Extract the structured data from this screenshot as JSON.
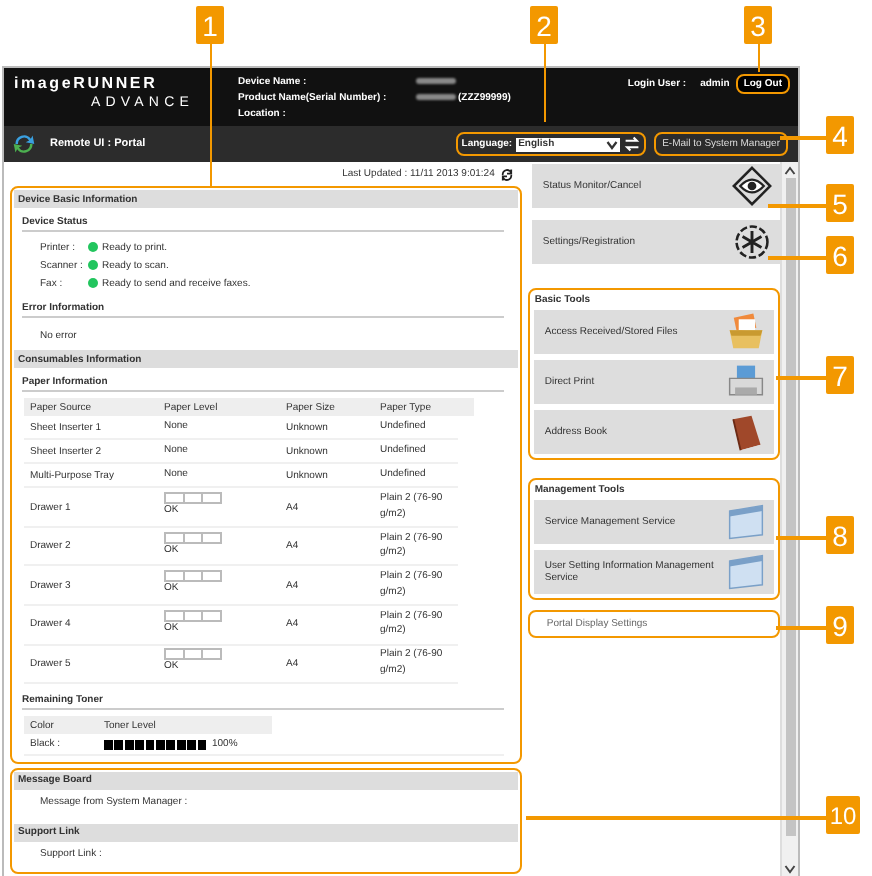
{
  "callouts": [
    "1",
    "2",
    "3",
    "4",
    "5",
    "6",
    "7",
    "8",
    "9",
    "10"
  ],
  "header": {
    "logo": [
      "imageRUNNER",
      "ADVANCE"
    ],
    "device_fields": [
      {
        "label": "Device Name :",
        "blurred": true
      },
      {
        "label": "Product Name(Serial Number) :",
        "blurred": true,
        "value": "(ZZZ99999)"
      },
      {
        "label": "Location :",
        "blurred": false
      }
    ],
    "login_label": "Login User :",
    "user": "admin",
    "logout": "Log Out"
  },
  "toolbar": {
    "title": "Remote UI : Portal",
    "language_label": "Language:",
    "language": "English",
    "email_button": "E-Mail to System Manager"
  },
  "last_updated": "Last Updated : 11/11 2013 9:01:24",
  "device_basic": {
    "title": "Device Basic Information",
    "status_title": "Device Status",
    "statuses": [
      {
        "label": "Printer :",
        "text": "Ready to print.",
        "color": "#22c55e"
      },
      {
        "label": "Scanner :",
        "text": "Ready to scan.",
        "color": "#22c55e"
      },
      {
        "label": "Fax :",
        "text": "Ready to send and receive faxes.",
        "color": "#22c55e"
      }
    ],
    "error_title": "Error Information",
    "error_text": "No error"
  },
  "consumables": {
    "title": "Consumables Information",
    "paper_title": "Paper Information",
    "columns": [
      "Paper Source",
      "Paper Level",
      "Paper Size",
      "Paper Type"
    ],
    "rows": [
      {
        "kind": "text",
        "source": "Sheet Inserter 1",
        "level_text": "None",
        "size": "Unknown",
        "type": "Undefined"
      },
      {
        "kind": "text",
        "source": "Sheet Inserter 2",
        "level_text": "None",
        "size": "Unknown",
        "type": "Undefined"
      },
      {
        "kind": "text",
        "source": "Multi-Purpose Tray",
        "level_text": "None",
        "size": "Unknown",
        "type": "Undefined"
      },
      {
        "kind": "gauge",
        "source": "Drawer 1",
        "level_text": "OK",
        "size": "A4",
        "type": "Plain 2 (76-90 g/m2)"
      },
      {
        "kind": "gauge",
        "source": "Drawer 2",
        "level_text": "OK",
        "size": "A4",
        "type": "Plain 2 (76-90 g/m2)"
      },
      {
        "kind": "gauge",
        "source": "Drawer 3",
        "level_text": "OK",
        "size": "A4",
        "type": "Plain 2 (76-90 g/m2)"
      },
      {
        "kind": "gauge",
        "source": "Drawer 4",
        "level_text": "OK",
        "size": "A4",
        "type": "Plain 2 (76-90 g/m2)"
      },
      {
        "kind": "gauge",
        "source": "Drawer 5",
        "level_text": "OK",
        "size": "A4",
        "type": "Plain 2 (76-90 g/m2)"
      }
    ],
    "toner_title": "Remaining Toner",
    "toner_columns": [
      "Color",
      "Toner Level"
    ],
    "toner": [
      {
        "name": "Black :",
        "level": 1,
        "reading": "100%"
      }
    ]
  },
  "message_board": {
    "title": "Message Board",
    "text": "Message from System Manager :"
  },
  "support": {
    "title": "Support Link",
    "text": "Support Link :"
  },
  "right": {
    "main_buttons": [
      {
        "label": "Status Monitor/Cancel",
        "kind": "eye"
      },
      {
        "label": "Settings/Registration",
        "kind": "gear"
      }
    ],
    "groups": [
      {
        "title": "Basic Tools",
        "buttons": [
          {
            "label": "Access Received/Stored Files",
            "kind": "files"
          },
          {
            "label": "Direct Print",
            "kind": "printer"
          },
          {
            "label": "Address Book",
            "kind": "book"
          }
        ]
      },
      {
        "title": "Management Tools",
        "buttons": [
          {
            "label": "Service Management Service",
            "kind": "window"
          },
          {
            "label": "User Setting Information Management Service",
            "kind": "window"
          }
        ]
      }
    ],
    "portal_settings": "Portal Display Settings"
  }
}
